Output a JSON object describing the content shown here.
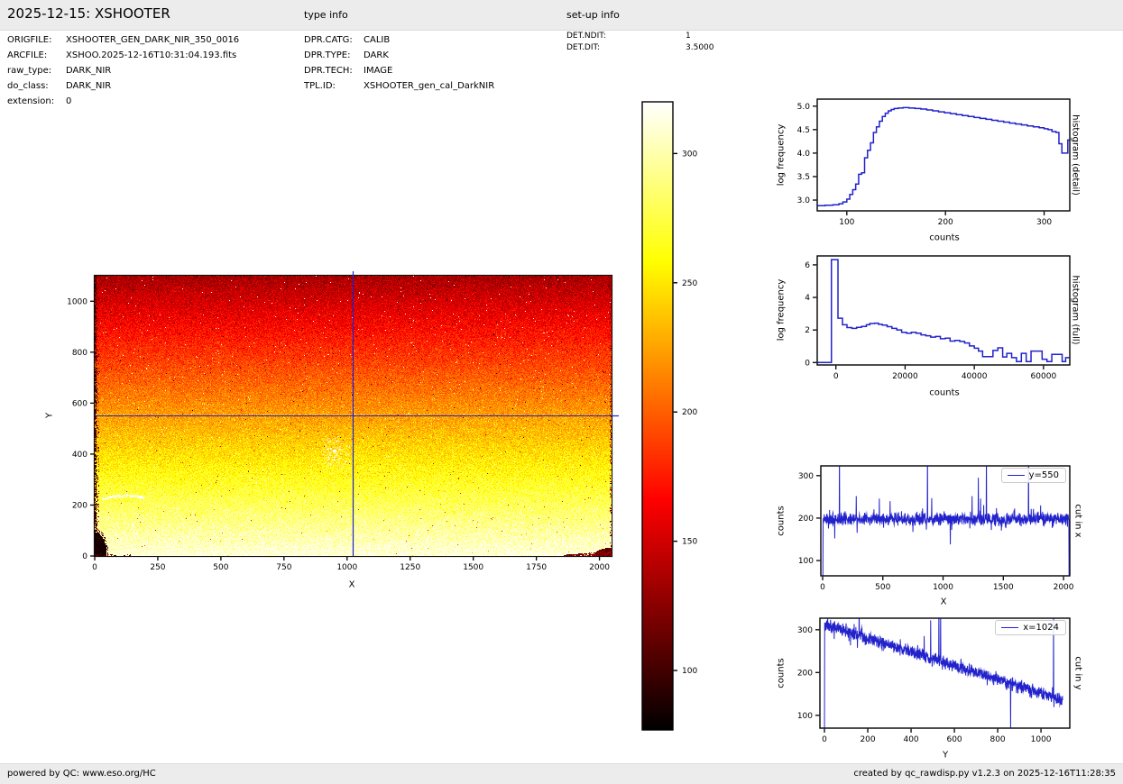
{
  "header": {
    "title": "2025-12-15: XSHOOTER",
    "type_info_label": "type info",
    "setup_info_label": "set-up info"
  },
  "file_info": {
    "rows": [
      {
        "label": "ORIGFILE:",
        "value": "XSHOOTER_GEN_DARK_NIR_350_0016"
      },
      {
        "label": "ARCFILE:",
        "value": "XSHOO.2025-12-16T10:31:04.193.fits"
      },
      {
        "label": "raw_type:",
        "value": "DARK_NIR"
      },
      {
        "label": "do_class:",
        "value": "DARK_NIR"
      },
      {
        "label": "extension:",
        "value": "0"
      }
    ]
  },
  "type_info": {
    "rows": [
      {
        "label": "DPR.CATG:",
        "value": "CALIB"
      },
      {
        "label": "DPR.TYPE:",
        "value": "DARK"
      },
      {
        "label": "DPR.TECH:",
        "value": "IMAGE"
      },
      {
        "label": "TPL.ID:",
        "value": "XSHOOTER_gen_cal_DarkNIR"
      }
    ]
  },
  "setup_info": {
    "rows": [
      {
        "label": "DET.NDIT:",
        "value": "1"
      },
      {
        "label": "DET.DIT:",
        "value": "3.5000"
      }
    ]
  },
  "footer": {
    "left": "powered by QC: www.eso.org/HC",
    "right": "created by qc_rawdisp.py v1.2.3 on 2025-12-16T11:28:35"
  },
  "chart_data": [
    {
      "id": "main-image",
      "type": "heatmap",
      "xlabel": "X",
      "ylabel": "Y",
      "xlim": [
        0,
        2048
      ],
      "ylim": [
        0,
        1100
      ],
      "xticks": [
        0,
        250,
        500,
        750,
        1000,
        1250,
        1500,
        1750,
        2000
      ],
      "yticks": [
        0,
        200,
        400,
        600,
        800,
        1000
      ],
      "colormap": "hot",
      "color_range": [
        77,
        320
      ],
      "vertical_gradient": {
        "counts_at_bottom": 312,
        "counts_at_top": 135
      },
      "noise_sigma": 11,
      "crosshair": {
        "x": 1024,
        "y": 550,
        "color": "#2222cc"
      },
      "defects": {
        "left_edge_dark_strip": true,
        "bottom_left_dark_blob": [
          46,
          92
        ],
        "bottom_right_dark_blob": [
          68,
          30
        ],
        "bottom_right_dark_streak_from_x": 1860,
        "white_scratch_center": [
          110,
          225
        ],
        "white_star_cluster_center": [
          950,
          400
        ]
      }
    },
    {
      "id": "colorbar",
      "type": "colorbar",
      "colormap": "hot",
      "range": [
        77,
        320
      ],
      "ticks": [
        100,
        150,
        200,
        250,
        300
      ]
    },
    {
      "id": "hist-detail",
      "type": "step",
      "right_label": "histogram (detail)",
      "xlabel": "counts",
      "ylabel": "log frequency",
      "xlim": [
        70,
        326
      ],
      "ylim": [
        2.77,
        5.15
      ],
      "xticks": [
        100,
        200,
        300
      ],
      "yticks": [
        3.0,
        3.5,
        4.0,
        4.5,
        5.0
      ],
      "ytick_decimals": 1,
      "color": "#2222cc",
      "steps": [
        [
          70,
          2.88
        ],
        [
          78,
          2.89
        ],
        [
          86,
          2.9
        ],
        [
          92,
          2.92
        ],
        [
          96,
          2.96
        ],
        [
          100,
          3.02
        ],
        [
          103,
          3.12
        ],
        [
          106,
          3.22
        ],
        [
          109,
          3.34
        ],
        [
          112,
          3.55
        ],
        [
          115,
          3.58
        ],
        [
          118,
          3.9
        ],
        [
          121,
          4.06
        ],
        [
          124,
          4.22
        ],
        [
          127,
          4.44
        ],
        [
          130,
          4.56
        ],
        [
          133,
          4.68
        ],
        [
          136,
          4.78
        ],
        [
          139,
          4.85
        ],
        [
          142,
          4.9
        ],
        [
          145,
          4.93
        ],
        [
          148,
          4.95
        ],
        [
          152,
          4.96
        ],
        [
          157,
          4.97
        ],
        [
          163,
          4.96
        ],
        [
          169,
          4.95
        ],
        [
          175,
          4.94
        ],
        [
          181,
          4.92
        ],
        [
          187,
          4.9
        ],
        [
          193,
          4.88
        ],
        [
          199,
          4.86
        ],
        [
          205,
          4.84
        ],
        [
          211,
          4.82
        ],
        [
          217,
          4.8
        ],
        [
          223,
          4.78
        ],
        [
          229,
          4.76
        ],
        [
          235,
          4.74
        ],
        [
          241,
          4.72
        ],
        [
          247,
          4.7
        ],
        [
          253,
          4.68
        ],
        [
          259,
          4.66
        ],
        [
          265,
          4.64
        ],
        [
          271,
          4.62
        ],
        [
          277,
          4.6
        ],
        [
          283,
          4.58
        ],
        [
          289,
          4.56
        ],
        [
          295,
          4.54
        ],
        [
          300,
          4.52
        ],
        [
          304,
          4.5
        ],
        [
          308,
          4.46
        ],
        [
          312,
          4.44
        ],
        [
          315,
          4.2
        ],
        [
          318,
          4.0
        ],
        [
          322,
          4.0
        ],
        [
          324,
          4.28
        ],
        [
          326,
          4.28
        ]
      ]
    },
    {
      "id": "hist-full",
      "type": "step",
      "right_label": "histogram (full)",
      "xlabel": "counts",
      "ylabel": "log frequency",
      "xlim": [
        -5400,
        67600
      ],
      "ylim": [
        -0.15,
        6.55
      ],
      "xticks": [
        0,
        20000,
        40000,
        60000
      ],
      "yticks": [
        0,
        2,
        4,
        6
      ],
      "ytick_decimals": 0,
      "color": "#2222cc",
      "steps": [
        [
          -5400,
          0
        ],
        [
          -1300,
          6.32
        ],
        [
          600,
          2.72
        ],
        [
          1900,
          2.32
        ],
        [
          3200,
          2.15
        ],
        [
          4600,
          2.1
        ],
        [
          6000,
          2.16
        ],
        [
          7400,
          2.22
        ],
        [
          8800,
          2.32
        ],
        [
          9800,
          2.4
        ],
        [
          11200,
          2.42
        ],
        [
          12300,
          2.35
        ],
        [
          13400,
          2.3
        ],
        [
          14800,
          2.2
        ],
        [
          16200,
          2.1
        ],
        [
          17600,
          2.0
        ],
        [
          19000,
          1.86
        ],
        [
          20400,
          1.8
        ],
        [
          21800,
          1.86
        ],
        [
          23200,
          1.8
        ],
        [
          24600,
          1.7
        ],
        [
          26000,
          1.64
        ],
        [
          27400,
          1.56
        ],
        [
          28800,
          1.6
        ],
        [
          30200,
          1.46
        ],
        [
          31600,
          1.5
        ],
        [
          33000,
          1.32
        ],
        [
          34400,
          1.36
        ],
        [
          35800,
          1.3
        ],
        [
          37200,
          1.2
        ],
        [
          38600,
          1.02
        ],
        [
          40000,
          0.88
        ],
        [
          41200,
          0.7
        ],
        [
          42400,
          0.36
        ],
        [
          44000,
          0.36
        ],
        [
          45400,
          0.74
        ],
        [
          46800,
          0.9
        ],
        [
          48200,
          0.34
        ],
        [
          49400,
          0.56
        ],
        [
          50800,
          0.3
        ],
        [
          52200,
          0.06
        ],
        [
          53600,
          0.56
        ],
        [
          55000,
          0.06
        ],
        [
          56400,
          0.7
        ],
        [
          58200,
          0.7
        ],
        [
          59600,
          0.2
        ],
        [
          61000,
          0.06
        ],
        [
          62400,
          0.5
        ],
        [
          64200,
          0.5
        ],
        [
          65400,
          0.06
        ],
        [
          66400,
          0.3
        ],
        [
          67600,
          0.3
        ]
      ]
    },
    {
      "id": "cut-x",
      "type": "signal",
      "legend": "y=550",
      "right_label": "cut in x",
      "xlabel": "X",
      "ylabel": "counts",
      "xlim": [
        -15,
        2052
      ],
      "ylim": [
        64,
        323
      ],
      "xticks": [
        0,
        500,
        1000,
        1500,
        2000
      ],
      "yticks": [
        100,
        200,
        300
      ],
      "ytick_decimals": 0,
      "color": "#2222cc",
      "signal": {
        "x_start": 2,
        "x_end": 2046,
        "n": 1100,
        "base_start": 198,
        "base_end": 198,
        "sigma": 7,
        "seed": 7,
        "spikes": [
          [
            2,
            60
          ],
          [
            100,
            152
          ],
          [
            140,
            360
          ],
          [
            280,
            252
          ],
          [
            470,
            246
          ],
          [
            560,
            240
          ],
          [
            870,
            360
          ],
          [
            905,
            247
          ],
          [
            1060,
            138
          ],
          [
            1240,
            252
          ],
          [
            1292,
            295
          ],
          [
            1312,
            246
          ],
          [
            1360,
            360
          ],
          [
            1710,
            360
          ],
          [
            2046,
            60
          ]
        ]
      }
    },
    {
      "id": "cut-y",
      "type": "signal",
      "legend": "x=1024",
      "right_label": "cut in y",
      "xlabel": "Y",
      "ylabel": "counts",
      "xlim": [
        -21,
        1133
      ],
      "ylim": [
        70,
        327
      ],
      "xticks": [
        0,
        200,
        400,
        600,
        800,
        1000
      ],
      "yticks": [
        100,
        200,
        300
      ],
      "ytick_decimals": 0,
      "color": "#2222cc",
      "signal": {
        "x_start": 0,
        "x_end": 1100,
        "n": 1100,
        "base_start": 312,
        "base_end": 136,
        "sigma": 7,
        "seed": 11,
        "spikes": [
          [
            0,
            60
          ],
          [
            160,
            360
          ],
          [
            460,
            285
          ],
          [
            490,
            322
          ],
          [
            528,
            360
          ],
          [
            536,
            348
          ],
          [
            860,
            60
          ],
          [
            1058,
            332
          ]
        ]
      }
    }
  ]
}
